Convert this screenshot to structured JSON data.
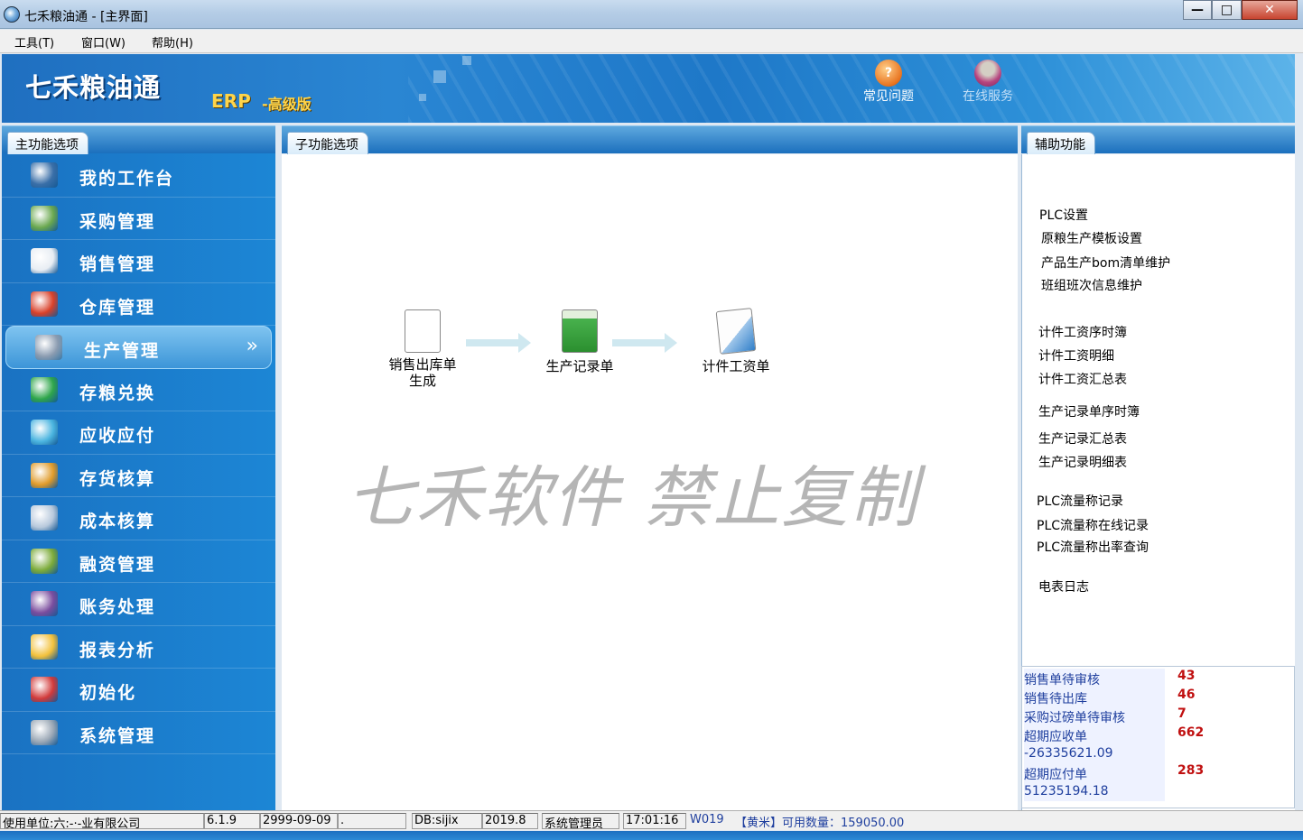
{
  "window": {
    "title": "七禾粮油通 - [主界面]",
    "min_label": "—",
    "max_label": "□",
    "close_label": "✕"
  },
  "menu": [
    "工具(T)",
    "窗口(W)",
    "帮助(H)"
  ],
  "banner": {
    "logo": "七禾粮油通",
    "erp": "ERP",
    "edition": "-高级版",
    "faq_icon_char": "?",
    "faq_label": "常见问题",
    "online_label": "在线服务"
  },
  "panels": {
    "main": "主功能选项",
    "sub": "子功能选项",
    "aux": "辅助功能"
  },
  "nav": [
    {
      "label": "我的工作台",
      "icon": "workbench-icon",
      "color": "#3a6fa8"
    },
    {
      "label": "采购管理",
      "icon": "truck-icon",
      "color": "#6aa84f"
    },
    {
      "label": "销售管理",
      "icon": "sales-doc-icon",
      "color": "#e8edf3"
    },
    {
      "label": "仓库管理",
      "icon": "house-icon",
      "color": "#d9412a"
    },
    {
      "label": "生产管理",
      "icon": "factory-icon",
      "color": "#8a9bb0",
      "active": true,
      "chevron": "»"
    },
    {
      "label": "存粮兑换",
      "icon": "exchange-arrows-icon",
      "color": "#2fa64b"
    },
    {
      "label": "应收应付",
      "icon": "flask-icon",
      "color": "#4bb5e0"
    },
    {
      "label": "存货核算",
      "icon": "bar-chart-icon",
      "color": "#e09b2a"
    },
    {
      "label": "成本核算",
      "icon": "calculator-icon",
      "color": "#b8c9dc"
    },
    {
      "label": "融资管理",
      "icon": "money-icon",
      "color": "#7cab3a"
    },
    {
      "label": "账务处理",
      "icon": "ledger-icon",
      "color": "#7b4d9e"
    },
    {
      "label": "报表分析",
      "icon": "report-icon",
      "color": "#f2c13c"
    },
    {
      "label": "初始化",
      "icon": "clipboard-check-icon",
      "color": "#d23a3a"
    },
    {
      "label": "系统管理",
      "icon": "tools-icon",
      "color": "#9aa7b5"
    }
  ],
  "flow": {
    "node1": "销售出库单\n生成",
    "node2": "生产记录单",
    "node3": "计件工资单"
  },
  "watermark": "七禾软件 禁止复制",
  "aux_links": [
    "PLC设置",
    "原粮生产模板设置",
    "产品生产bom清单维护",
    "班组班次信息维护",
    "计件工资序时簿",
    "计件工资明细",
    "计件工资汇总表",
    "生产记录单序时簿",
    "生产记录汇总表",
    "生产记录明细表",
    "PLC流量称记录",
    "PLC流量称在线记录",
    "PLC流量称出率查询",
    "电表日志"
  ],
  "stats": [
    {
      "label": "销售单待审核",
      "value": "43"
    },
    {
      "label": "销售待出库",
      "value": "46"
    },
    {
      "label": "采购过磅单待审核",
      "value": "7"
    },
    {
      "label": "超期应收单",
      "value": "662"
    },
    {
      "label": "-26335621.09",
      "value": ""
    },
    {
      "label": "超期应付单",
      "value": "283"
    },
    {
      "label": "51235194.18",
      "value": ""
    }
  ],
  "status": {
    "unit": "使用单位:六:-·-业有限公司",
    "version": "6.1.9",
    "date": "2999-09-09",
    "blank": ".",
    "db": "DB:sijix",
    "db_version": "2019.8",
    "user": "系统管理员",
    "time": "17:01:16",
    "code": "W019",
    "product": "【黄米】可用数量：159050.00"
  }
}
